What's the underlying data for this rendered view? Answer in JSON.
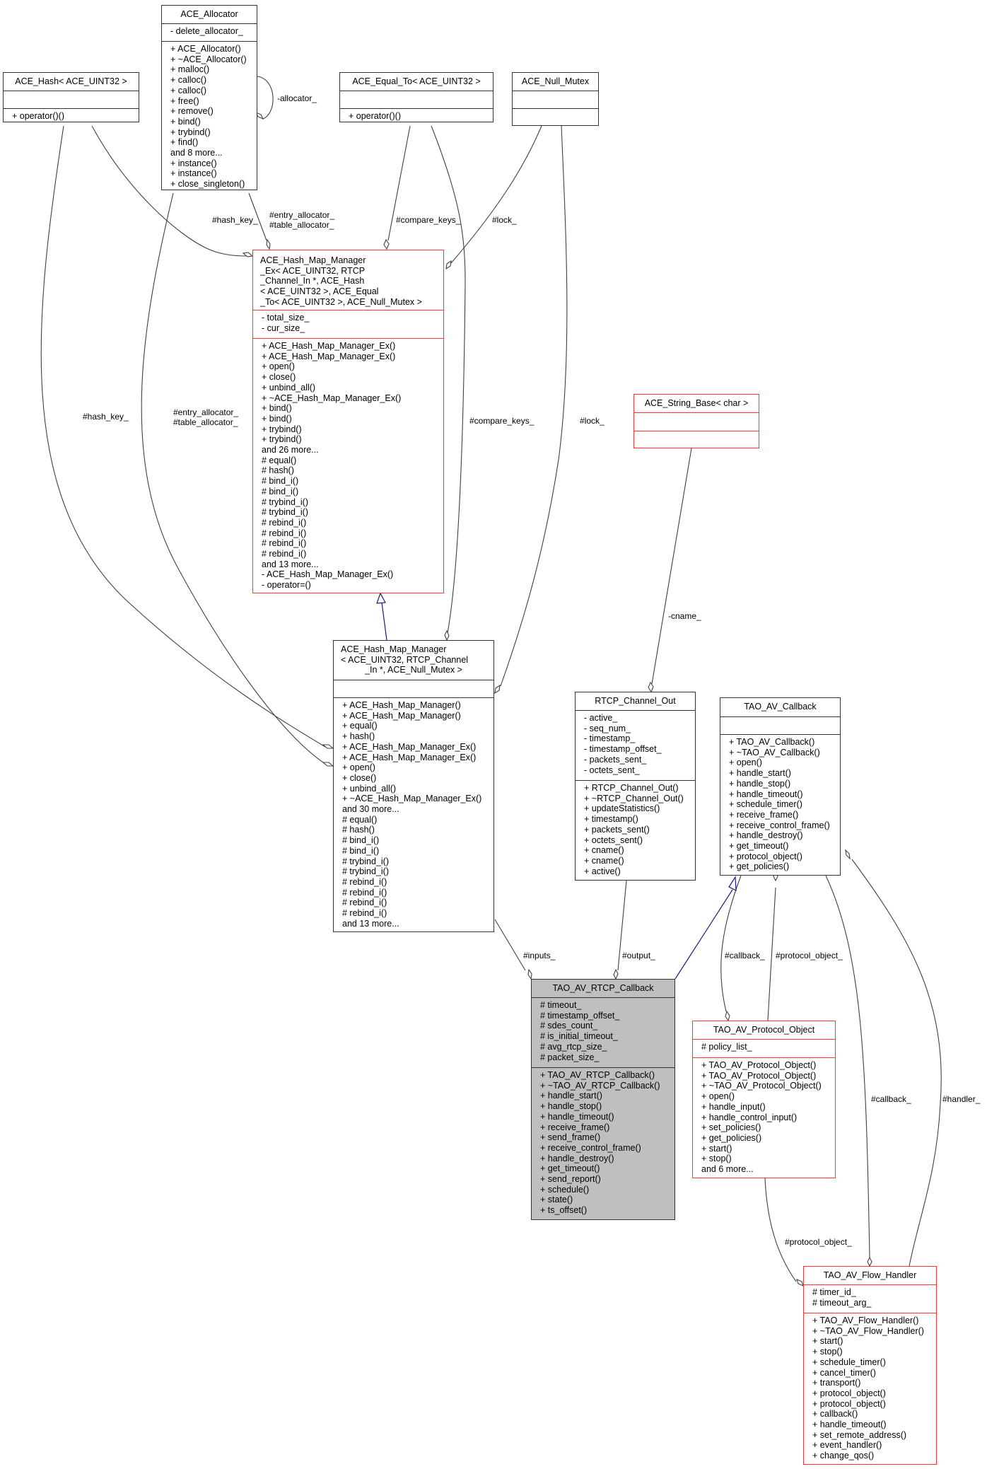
{
  "colors": {
    "edge": "#404040",
    "inherit": "#1a1a80",
    "red_border": "#ff3333",
    "focus_fill": "#bfbfbf"
  },
  "nodes": {
    "ace_hash": {
      "title": [
        "ACE_Hash< ACE_UINT32 >"
      ],
      "attributes": [],
      "methods": [
        "+ operator()()"
      ]
    },
    "ace_allocator": {
      "title": [
        "ACE_Allocator"
      ],
      "attributes": [
        "- delete_allocator_"
      ],
      "methods": [
        "+ ACE_Allocator()",
        "+ ~ACE_Allocator()",
        "+ malloc()",
        "+ calloc()",
        "+ calloc()",
        "+ free()",
        "+ remove()",
        "+ bind()",
        "+ trybind()",
        "+ find()",
        "and 8 more...",
        "+ instance()",
        "+ instance()",
        "+ close_singleton()"
      ]
    },
    "ace_equal_to": {
      "title": [
        "ACE_Equal_To< ACE_UINT32 >"
      ],
      "attributes": [],
      "methods": [
        "+ operator()()"
      ]
    },
    "ace_null_mutex": {
      "title": [
        "ACE_Null_Mutex"
      ],
      "attributes": [],
      "methods": []
    },
    "hash_map_manager_ex": {
      "title": [
        "ACE_Hash_Map_Manager",
        "_Ex< ACE_UINT32, RTCP",
        "_Channel_In *, ACE_Hash",
        "< ACE_UINT32 >, ACE_Equal",
        "_To< ACE_UINT32 >, ACE_Null_Mutex >"
      ],
      "attributes": [
        "- total_size_",
        "- cur_size_"
      ],
      "methods": [
        "+ ACE_Hash_Map_Manager_Ex()",
        "+ ACE_Hash_Map_Manager_Ex()",
        "+ open()",
        "+ close()",
        "+ unbind_all()",
        "+ ~ACE_Hash_Map_Manager_Ex()",
        "+ bind()",
        "+ bind()",
        "+ trybind()",
        "+ trybind()",
        "and 26 more...",
        "# equal()",
        "# hash()",
        "# bind_i()",
        "# bind_i()",
        "# trybind_i()",
        "# trybind_i()",
        "# rebind_i()",
        "# rebind_i()",
        "# rebind_i()",
        "# rebind_i()",
        "and 13 more...",
        "- ACE_Hash_Map_Manager_Ex()",
        "- operator=()"
      ]
    },
    "ace_string_base": {
      "title": [
        "ACE_String_Base< char >"
      ],
      "attributes": [],
      "methods": []
    },
    "hash_map_manager": {
      "title": [
        "ACE_Hash_Map_Manager",
        "< ACE_UINT32, RTCP_Channel",
        "_In *, ACE_Null_Mutex >"
      ],
      "attributes": [],
      "methods": [
        "+ ACE_Hash_Map_Manager()",
        "+ ACE_Hash_Map_Manager()",
        "+ equal()",
        "+ hash()",
        "+ ACE_Hash_Map_Manager_Ex()",
        "+ ACE_Hash_Map_Manager_Ex()",
        "+ open()",
        "+ close()",
        "+ unbind_all()",
        "+ ~ACE_Hash_Map_Manager_Ex()",
        "and 30 more...",
        "# equal()",
        "# hash()",
        "# bind_i()",
        "# bind_i()",
        "# trybind_i()",
        "# trybind_i()",
        "# rebind_i()",
        "# rebind_i()",
        "# rebind_i()",
        "# rebind_i()",
        "and 13 more..."
      ]
    },
    "rtcp_channel_out": {
      "title": [
        "RTCP_Channel_Out"
      ],
      "attributes": [
        "- active_",
        "- seq_num_",
        "- timestamp_",
        "- timestamp_offset_",
        "- packets_sent_",
        "- octets_sent_"
      ],
      "methods": [
        "+ RTCP_Channel_Out()",
        "+ ~RTCP_Channel_Out()",
        "+ updateStatistics()",
        "+ timestamp()",
        "+ packets_sent()",
        "+ octets_sent()",
        "+ cname()",
        "+ cname()",
        "+ active()"
      ]
    },
    "tao_av_callback": {
      "title": [
        "TAO_AV_Callback"
      ],
      "attributes": [],
      "methods": [
        "+ TAO_AV_Callback()",
        "+ ~TAO_AV_Callback()",
        "+ open()",
        "+ handle_start()",
        "+ handle_stop()",
        "+ handle_timeout()",
        "+ schedule_timer()",
        "+ receive_frame()",
        "+ receive_control_frame()",
        "+ handle_destroy()",
        "+ get_timeout()",
        "+ protocol_object()",
        "+ get_policies()"
      ]
    },
    "tao_av_rtcp_callback": {
      "title": [
        "TAO_AV_RTCP_Callback"
      ],
      "attributes": [
        "# timeout_",
        "# timestamp_offset_",
        "# sdes_count_",
        "# is_initial_timeout_",
        "# avg_rtcp_size_",
        "# packet_size_"
      ],
      "methods": [
        "+ TAO_AV_RTCP_Callback()",
        "+ ~TAO_AV_RTCP_Callback()",
        "+ handle_start()",
        "+ handle_stop()",
        "+ handle_timeout()",
        "+ receive_frame()",
        "+ send_frame()",
        "+ receive_control_frame()",
        "+ handle_destroy()",
        "+ get_timeout()",
        "+ send_report()",
        "+ schedule()",
        "+ state()",
        "+ ts_offset()"
      ]
    },
    "tao_av_protocol_object": {
      "title": [
        "TAO_AV_Protocol_Object"
      ],
      "attributes": [
        "# policy_list_"
      ],
      "methods": [
        "+ TAO_AV_Protocol_Object()",
        "+ TAO_AV_Protocol_Object()",
        "+ ~TAO_AV_Protocol_Object()",
        "+ open()",
        "+ handle_input()",
        "+ handle_control_input()",
        "+ set_policies()",
        "+ get_policies()",
        "+ start()",
        "+ stop()",
        "and 6 more..."
      ]
    },
    "tao_av_flow_handler": {
      "title": [
        "TAO_AV_Flow_Handler"
      ],
      "attributes": [
        "# timer_id_",
        "# timeout_arg_"
      ],
      "methods": [
        "+ TAO_AV_Flow_Handler()",
        "+ ~TAO_AV_Flow_Handler()",
        "+ start()",
        "+ stop()",
        "+ schedule_timer()",
        "+ cancel_timer()",
        "+ transport()",
        "+ protocol_object()",
        "+ protocol_object()",
        "+ callback()",
        "+ handle_timeout()",
        "+ set_remote_address()",
        "+ event_handler()",
        "+ change_qos()"
      ]
    }
  },
  "edge_labels": {
    "allocator": "-allocator_",
    "hash_key_upper": "#hash_key_",
    "entry_table_alloc_upper": [
      "#entry_allocator_",
      "#table_allocator_"
    ],
    "compare_keys_upper": "#compare_keys_",
    "lock_upper": "#lock_",
    "hash_key_lower": "#hash_key_",
    "entry_table_alloc_lower": [
      "#entry_allocator_",
      "#table_allocator_"
    ],
    "compare_keys_lower": "#compare_keys_",
    "lock_lower": "#lock_",
    "cname": "-cname_",
    "inputs": "#inputs_",
    "output": "#output_",
    "callback_po": "#callback_",
    "protocol_object_cb": "#protocol_object_",
    "callback_fh": "#callback_",
    "handler": "#handler_",
    "protocol_object_fh": "#protocol_object_"
  }
}
